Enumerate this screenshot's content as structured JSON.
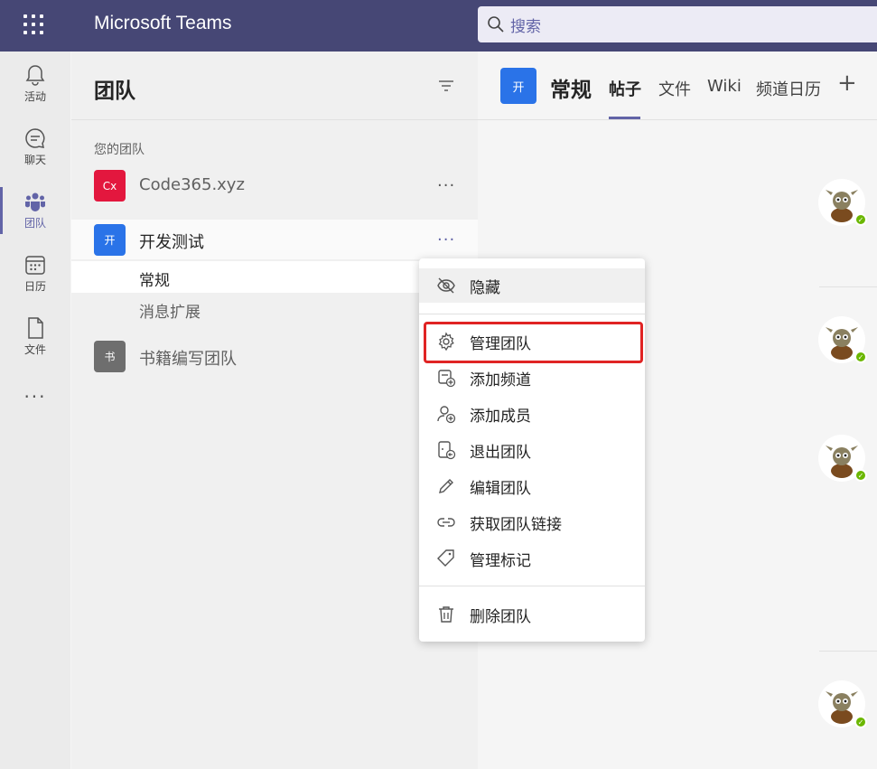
{
  "app": {
    "title": "Microsoft Teams"
  },
  "search": {
    "placeholder": "搜索"
  },
  "rail": {
    "items": [
      {
        "label": "活动",
        "icon": "bell-icon"
      },
      {
        "label": "聊天",
        "icon": "chat-icon"
      },
      {
        "label": "团队",
        "icon": "teams-icon",
        "active": true
      },
      {
        "label": "日历",
        "icon": "calendar-icon"
      },
      {
        "label": "文件",
        "icon": "file-icon"
      }
    ],
    "more": "···"
  },
  "panel": {
    "title": "团队",
    "section_label": "您的团队",
    "teams": [
      {
        "name": "Code365.xyz",
        "avatar_text": "Cx",
        "avatar_color": "#e3173e",
        "more": "···"
      },
      {
        "name": "开发测试",
        "avatar_text": "开",
        "avatar_color": "#2a73e8",
        "more": "···",
        "channels": [
          {
            "name": "常规",
            "active": true
          },
          {
            "name": "消息扩展"
          }
        ]
      },
      {
        "name": "书籍编写团队",
        "avatar_text": "书",
        "avatar_color": "#6e6e6e"
      }
    ]
  },
  "channel": {
    "avatar_text": "开",
    "title": "常规",
    "tabs": [
      {
        "label": "帖子",
        "active": true
      },
      {
        "label": "文件"
      },
      {
        "label": "Wiki"
      },
      {
        "label": "频道日历"
      }
    ],
    "add_tab": "+"
  },
  "context_menu": {
    "items": [
      {
        "label": "隐藏",
        "icon": "eye-hidden-icon"
      },
      {
        "label": "管理团队",
        "icon": "gear-icon",
        "highlighted": true
      },
      {
        "label": "添加频道",
        "icon": "add-channel-icon"
      },
      {
        "label": "添加成员",
        "icon": "add-member-icon"
      },
      {
        "label": "退出团队",
        "icon": "leave-team-icon"
      },
      {
        "label": "编辑团队",
        "icon": "pencil-icon"
      },
      {
        "label": "获取团队链接",
        "icon": "link-icon"
      },
      {
        "label": "管理标记",
        "icon": "tag-icon"
      },
      {
        "label": "删除团队",
        "icon": "trash-icon"
      }
    ]
  },
  "colors": {
    "brand": "#464775",
    "accent": "#6264a7",
    "highlight": "#e02424",
    "presence": "#6bb700"
  }
}
